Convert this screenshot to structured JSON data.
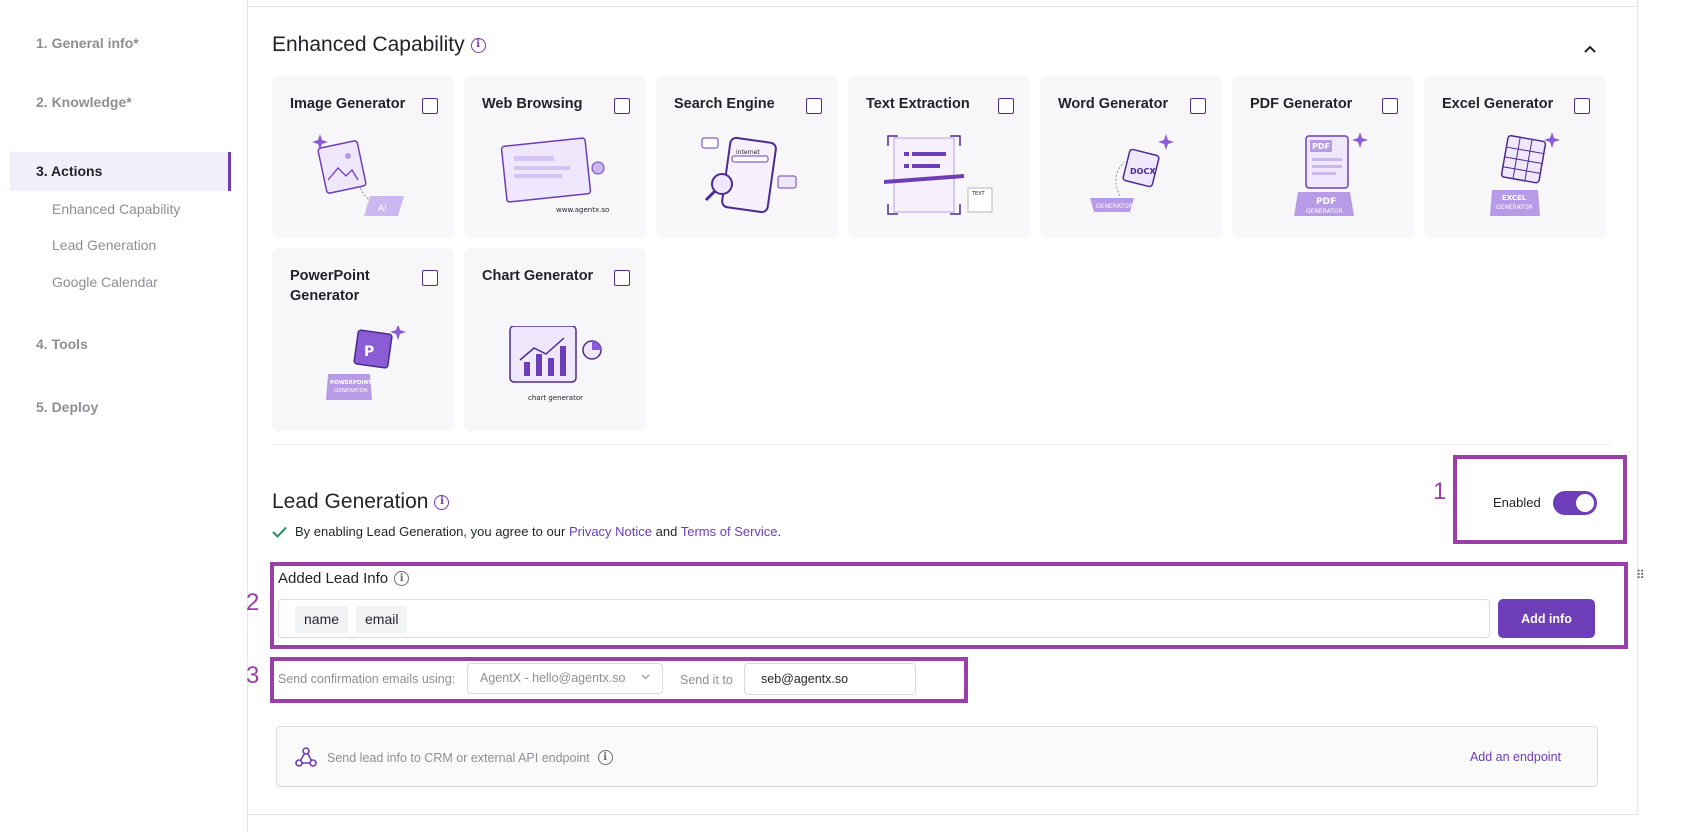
{
  "sidebar": {
    "steps": [
      {
        "label": "1. General info*"
      },
      {
        "label": "2. Knowledge*"
      },
      {
        "label": "3. Actions"
      },
      {
        "label": "4. Tools"
      },
      {
        "label": "5. Deploy"
      }
    ],
    "sub_items": [
      {
        "label": "Enhanced Capability"
      },
      {
        "label": "Lead Generation"
      },
      {
        "label": "Google Calendar"
      }
    ]
  },
  "enhanced": {
    "title": "Enhanced Capability",
    "capabilities": [
      {
        "label": "Image Generator",
        "icon": "image-generator-illustration",
        "checked": false
      },
      {
        "label": "Web Browsing",
        "icon": "web-browsing-illustration",
        "illus_text": "www.agentx.so",
        "checked": false
      },
      {
        "label": "Search Engine",
        "icon": "search-engine-illustration",
        "illus_text": "internet",
        "checked": false
      },
      {
        "label": "Text Extraction",
        "icon": "text-extraction-illustration",
        "illus_text": "TEXT",
        "checked": false
      },
      {
        "label": "Word Generator",
        "icon": "word-generator-illustration",
        "illus_text": "DOCX",
        "illus_text2": "GENERATOR",
        "checked": false
      },
      {
        "label": "PDF Generator",
        "icon": "pdf-generator-illustration",
        "illus_text": "PDF",
        "illus_text2": "PDF",
        "illus_text3": "GENERATOR",
        "checked": false
      },
      {
        "label": "Excel Generator",
        "icon": "excel-generator-illustration",
        "illus_text": "EXCEL",
        "illus_text2": "GENERATOR",
        "checked": false
      },
      {
        "label": "PowerPoint Generator",
        "icon": "powerpoint-generator-illustration",
        "illus_text": "POWERPOINT",
        "illus_text2": "GENERATOR",
        "checked": false
      },
      {
        "label": "Chart Generator",
        "icon": "chart-generator-illustration",
        "illus_text": "chart generator",
        "checked": false
      }
    ]
  },
  "lead": {
    "title": "Lead Generation",
    "consent_prefix": "By enabling Lead Generation, you agree to our",
    "privacy_link": "Privacy Notice",
    "and_text": "and",
    "terms_link": "Terms of Service",
    "period": ".",
    "enabled_label": "Enabled",
    "enabled": true,
    "added_info_label": "Added Lead Info",
    "tags": [
      "name",
      "email"
    ],
    "add_info_button": "Add info",
    "confirm_label": "Send confirmation emails using:",
    "sender_value": "AgentX - hello@agentx.so",
    "send_to_label": "Send it to",
    "send_to_value": "seb@agentx.so",
    "endpoint_text": "Send lead info to CRM or external API endpoint",
    "endpoint_link": "Add an endpoint"
  },
  "annotations": [
    "1",
    "2",
    "3"
  ],
  "colors": {
    "accent": "#6e3db8",
    "annotation": "#9b3fa8",
    "check": "#1e8e5a"
  }
}
